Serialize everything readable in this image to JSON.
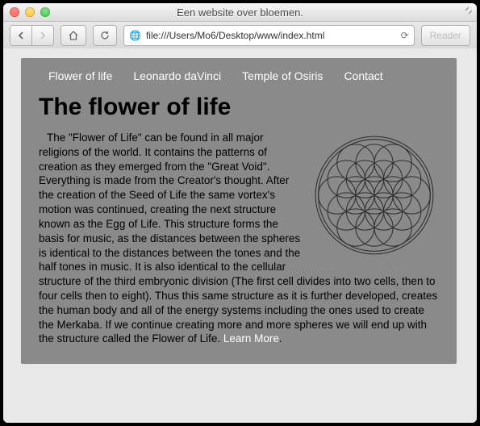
{
  "window": {
    "title": "Een website over bloemen.",
    "reader_label": "Reader"
  },
  "urlbar": {
    "scheme_icon": "🌐",
    "url": "file:///Users/Mo6/Desktop/www/index.html",
    "reload_icon": "⟳"
  },
  "nav": {
    "items": [
      "Flower of life",
      "Leonardo daVinci",
      "Temple of Osiris",
      "Contact"
    ]
  },
  "heading": "The flower of life",
  "body_text": "The \"Flower of Life\" can be found in all major religions of the world. It contains the patterns of creation as they emerged from the \"Great Void\". Everything is made from the Creator's thought. After the creation of the Seed of Life the same vortex's motion was continued, creating the next structure known as the Egg of Life. This structure forms the basis for music, as the distances between the spheres is identical to the distances between the tones and the half tones in music. It is also identical to the cellular structure of the third embryonic division (The first cell divides into two cells, then to four cells then to eight). Thus this same structure as it is further developed, creates the human body and all of the energy systems including the ones used to create the Merkaba. If we continue creating more and more spheres we will end up with the structure called the Flower of Life. ",
  "learn_more": "Learn More",
  "period": "."
}
